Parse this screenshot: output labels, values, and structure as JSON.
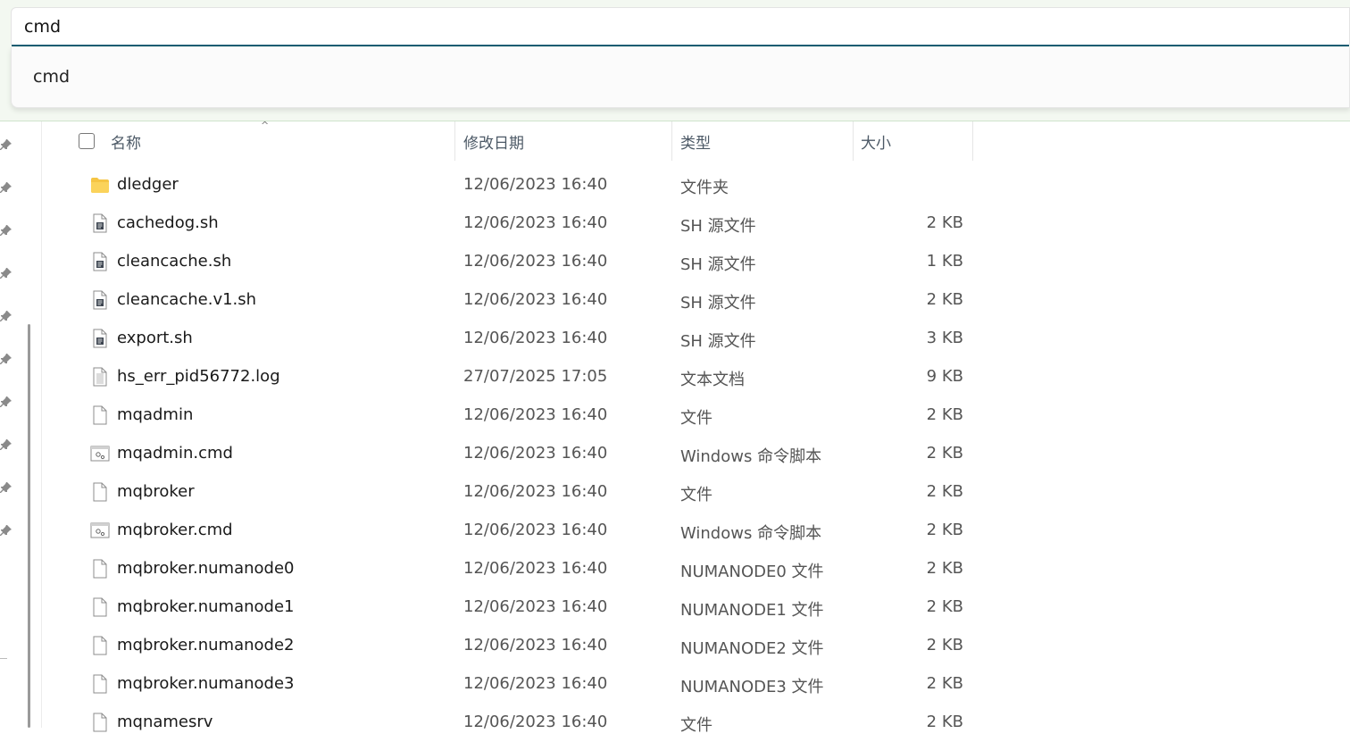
{
  "address_bar": {
    "value": "cmd"
  },
  "suggestions": [
    "cmd"
  ],
  "columns": {
    "name": "名称",
    "date": "修改日期",
    "type": "类型",
    "size": "大小"
  },
  "files": [
    {
      "name": "dledger",
      "date": "12/06/2023 16:40",
      "type": "文件夹",
      "size": "",
      "icon": "folder-icon"
    },
    {
      "name": "cachedog.sh",
      "date": "12/06/2023 16:40",
      "type": "SH 源文件",
      "size": "2 KB",
      "icon": "script-file-icon"
    },
    {
      "name": "cleancache.sh",
      "date": "12/06/2023 16:40",
      "type": "SH 源文件",
      "size": "1 KB",
      "icon": "script-file-icon"
    },
    {
      "name": "cleancache.v1.sh",
      "date": "12/06/2023 16:40",
      "type": "SH 源文件",
      "size": "2 KB",
      "icon": "script-file-icon"
    },
    {
      "name": "export.sh",
      "date": "12/06/2023 16:40",
      "type": "SH 源文件",
      "size": "3 KB",
      "icon": "script-file-icon"
    },
    {
      "name": "hs_err_pid56772.log",
      "date": "27/07/2025 17:05",
      "type": "文本文档",
      "size": "9 KB",
      "icon": "text-file-icon"
    },
    {
      "name": "mqadmin",
      "date": "12/06/2023 16:40",
      "type": "文件",
      "size": "2 KB",
      "icon": "blank-file-icon"
    },
    {
      "name": "mqadmin.cmd",
      "date": "12/06/2023 16:40",
      "type": "Windows 命令脚本",
      "size": "2 KB",
      "icon": "cmd-file-icon"
    },
    {
      "name": "mqbroker",
      "date": "12/06/2023 16:40",
      "type": "文件",
      "size": "2 KB",
      "icon": "blank-file-icon"
    },
    {
      "name": "mqbroker.cmd",
      "date": "12/06/2023 16:40",
      "type": "Windows 命令脚本",
      "size": "2 KB",
      "icon": "cmd-file-icon"
    },
    {
      "name": "mqbroker.numanode0",
      "date": "12/06/2023 16:40",
      "type": "NUMANODE0 文件",
      "size": "2 KB",
      "icon": "blank-file-icon"
    },
    {
      "name": "mqbroker.numanode1",
      "date": "12/06/2023 16:40",
      "type": "NUMANODE1 文件",
      "size": "2 KB",
      "icon": "blank-file-icon"
    },
    {
      "name": "mqbroker.numanode2",
      "date": "12/06/2023 16:40",
      "type": "NUMANODE2 文件",
      "size": "2 KB",
      "icon": "blank-file-icon"
    },
    {
      "name": "mqbroker.numanode3",
      "date": "12/06/2023 16:40",
      "type": "NUMANODE3 文件",
      "size": "2 KB",
      "icon": "blank-file-icon"
    },
    {
      "name": "mqnamesrv",
      "date": "12/06/2023 16:40",
      "type": "文件",
      "size": "2 KB",
      "icon": "blank-file-icon"
    }
  ],
  "colors": {
    "accent": "#1c5d73",
    "folder": "#f6c544",
    "header_text": "#4c5966"
  }
}
